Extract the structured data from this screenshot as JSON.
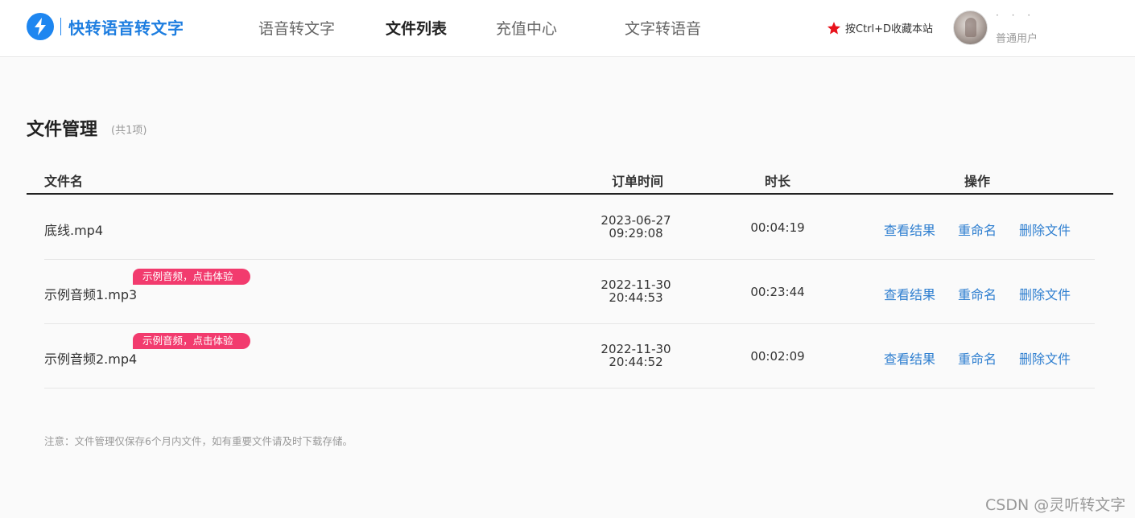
{
  "header": {
    "logo_text": "快转语音转文字",
    "nav": [
      {
        "label": "语音转文字"
      },
      {
        "label": "文件列表"
      },
      {
        "label": "充值中心"
      },
      {
        "label": "文字转语音"
      }
    ],
    "bookmark_text": "按Ctrl+D收藏本站",
    "user": {
      "name": "· · ·",
      "role": "普通用户"
    },
    "accent_color": "#1e86f0"
  },
  "main": {
    "title": "文件管理",
    "count": "(共1项)",
    "columns": [
      "文件名",
      "订单时间",
      "时长",
      "操作"
    ],
    "rows": [
      {
        "name": "底线.mp4",
        "badge": "",
        "date": "2023-06-27",
        "time": "09:29:08",
        "duration": "00:04:19"
      },
      {
        "name": "示例音频1.mp3",
        "badge": "示例音频，点击体验",
        "date": "2022-11-30",
        "time": "20:44:53",
        "duration": "00:23:44"
      },
      {
        "name": "示例音频2.mp4",
        "badge": "示例音频，点击体验",
        "date": "2022-11-30",
        "time": "20:44:52",
        "duration": "00:02:09"
      }
    ],
    "actions": {
      "view": "查看结果",
      "rename": "重命名",
      "delete": "删除文件"
    },
    "notice": "注意：文件管理仅保存6个月内文件，如有重要文件请及时下载存储。"
  },
  "watermark": "CSDN @灵听转文字",
  "colors": {
    "link": "#2f7fd0",
    "badge": "#f23b6e",
    "star": "#e8121b"
  },
  "icons": [
    "lightning-icon",
    "star-icon",
    "avatar"
  ]
}
